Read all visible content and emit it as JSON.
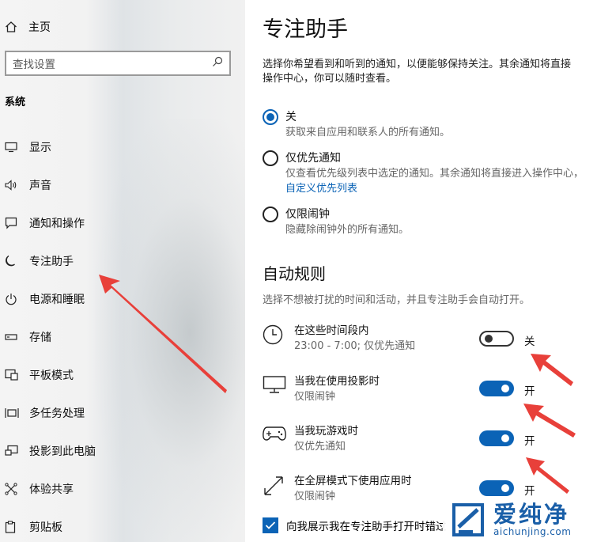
{
  "sidebar": {
    "home_label": "主页",
    "search_placeholder": "查找设置",
    "section_title": "系统",
    "items": [
      {
        "label": "显示",
        "icon": "monitor-icon"
      },
      {
        "label": "声音",
        "icon": "speaker-icon"
      },
      {
        "label": "通知和操作",
        "icon": "notification-icon"
      },
      {
        "label": "专注助手",
        "icon": "moon-icon"
      },
      {
        "label": "电源和睡眠",
        "icon": "power-icon"
      },
      {
        "label": "存储",
        "icon": "storage-icon"
      },
      {
        "label": "平板模式",
        "icon": "tablet-icon"
      },
      {
        "label": "多任务处理",
        "icon": "multitask-icon"
      },
      {
        "label": "投影到此电脑",
        "icon": "project-icon"
      },
      {
        "label": "体验共享",
        "icon": "share-icon"
      },
      {
        "label": "剪贴板",
        "icon": "clipboard-icon"
      }
    ]
  },
  "main": {
    "title": "专注助手",
    "description_line1": "选择你希望看到和听到的通知，以便能够保持关注。其余通知将直接",
    "description_line2": "操作中心，你可以随时查看。",
    "options": [
      {
        "label": "关",
        "sub": "获取来自应用和联系人的所有通知。",
        "selected": true
      },
      {
        "label": "仅优先通知",
        "sub": "仅查看优先级列表中选定的通知。其余通知将直接进入操作中心，",
        "link": "自定义优先列表",
        "selected": false
      },
      {
        "label": "仅限闹钟",
        "sub": "隐藏除闹钟外的所有通知。",
        "selected": false
      }
    ],
    "auto_rules_title": "自动规则",
    "auto_rules_desc": "选择不想被打扰的时间和活动，并且专注助手会自动打开。",
    "rules": [
      {
        "title": "在这些时间段内",
        "sub": "23:00 - 7:00; 仅优先通知",
        "state": "关",
        "on": false,
        "icon": "clock-icon"
      },
      {
        "title": "当我在使用投影时",
        "sub": "仅限闹钟",
        "state": "开",
        "on": true,
        "icon": "display-icon"
      },
      {
        "title": "当我玩游戏时",
        "sub": "仅优先通知",
        "state": "开",
        "on": true,
        "icon": "gamepad-icon"
      },
      {
        "title": "在全屏模式下使用应用时",
        "sub": "仅限闹钟",
        "state": "开",
        "on": true,
        "icon": "fullscreen-icon"
      }
    ],
    "checkbox_label": "向我展示我在专注助手打开时错过",
    "checkbox_checked": true
  },
  "watermark": {
    "big": "爱纯净",
    "small": "aichunjing.com"
  },
  "colors": {
    "accent": "#0b63b6",
    "arrow": "#e8403a"
  }
}
